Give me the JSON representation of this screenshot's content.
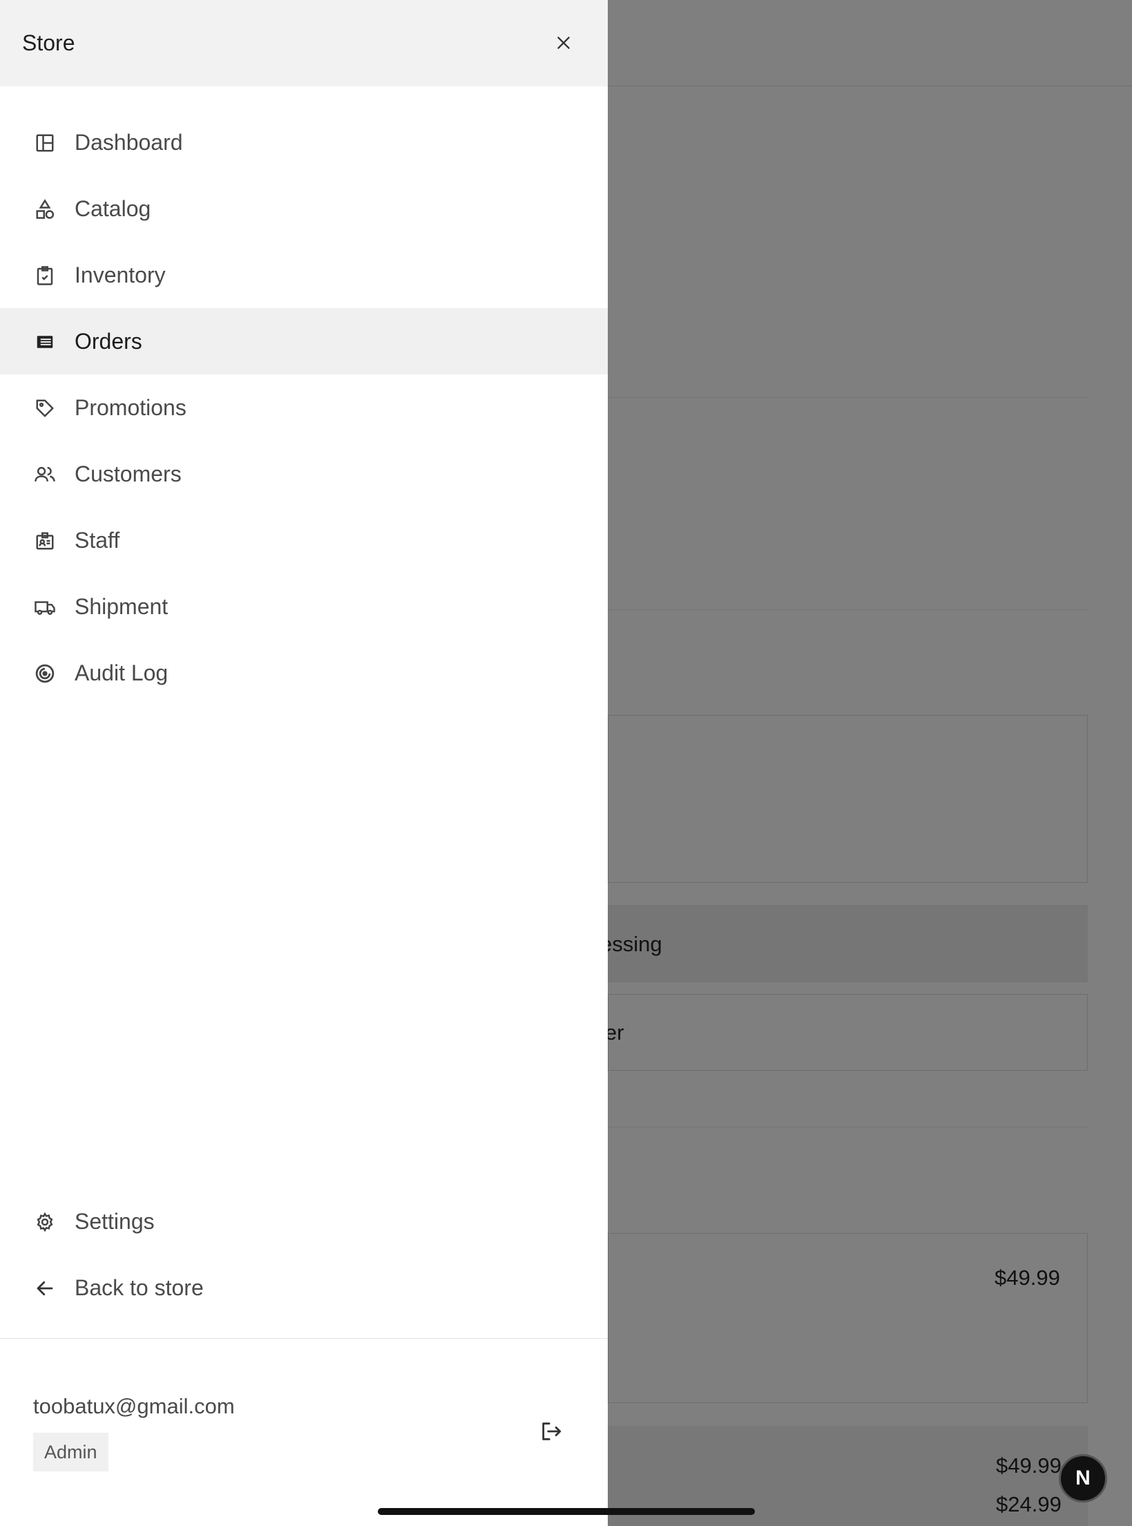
{
  "drawer": {
    "title": "Store",
    "nav_items": [
      {
        "label": "Dashboard",
        "icon": "dashboard-icon"
      },
      {
        "label": "Catalog",
        "icon": "shapes-icon"
      },
      {
        "label": "Inventory",
        "icon": "clipboard-check-icon"
      },
      {
        "label": "Orders",
        "icon": "list-icon",
        "active": true
      },
      {
        "label": "Promotions",
        "icon": "tag-icon"
      },
      {
        "label": "Customers",
        "icon": "users-icon"
      },
      {
        "label": "Staff",
        "icon": "id-card-icon"
      },
      {
        "label": "Shipment",
        "icon": "truck-icon"
      },
      {
        "label": "Audit Log",
        "icon": "radar-icon"
      }
    ],
    "bottom_items": [
      {
        "label": "Settings",
        "icon": "gear-icon"
      },
      {
        "label": "Back to store",
        "icon": "arrow-left-icon"
      }
    ],
    "user": {
      "email": "toobatux@gmail.com",
      "role": "Admin"
    }
  },
  "background": {
    "status_text": "essing",
    "select_text": "ler",
    "item_price_1": "$49.99",
    "summary_price_1": "$49.99",
    "summary_price_2": "$24.99"
  },
  "dev_badge": "N"
}
